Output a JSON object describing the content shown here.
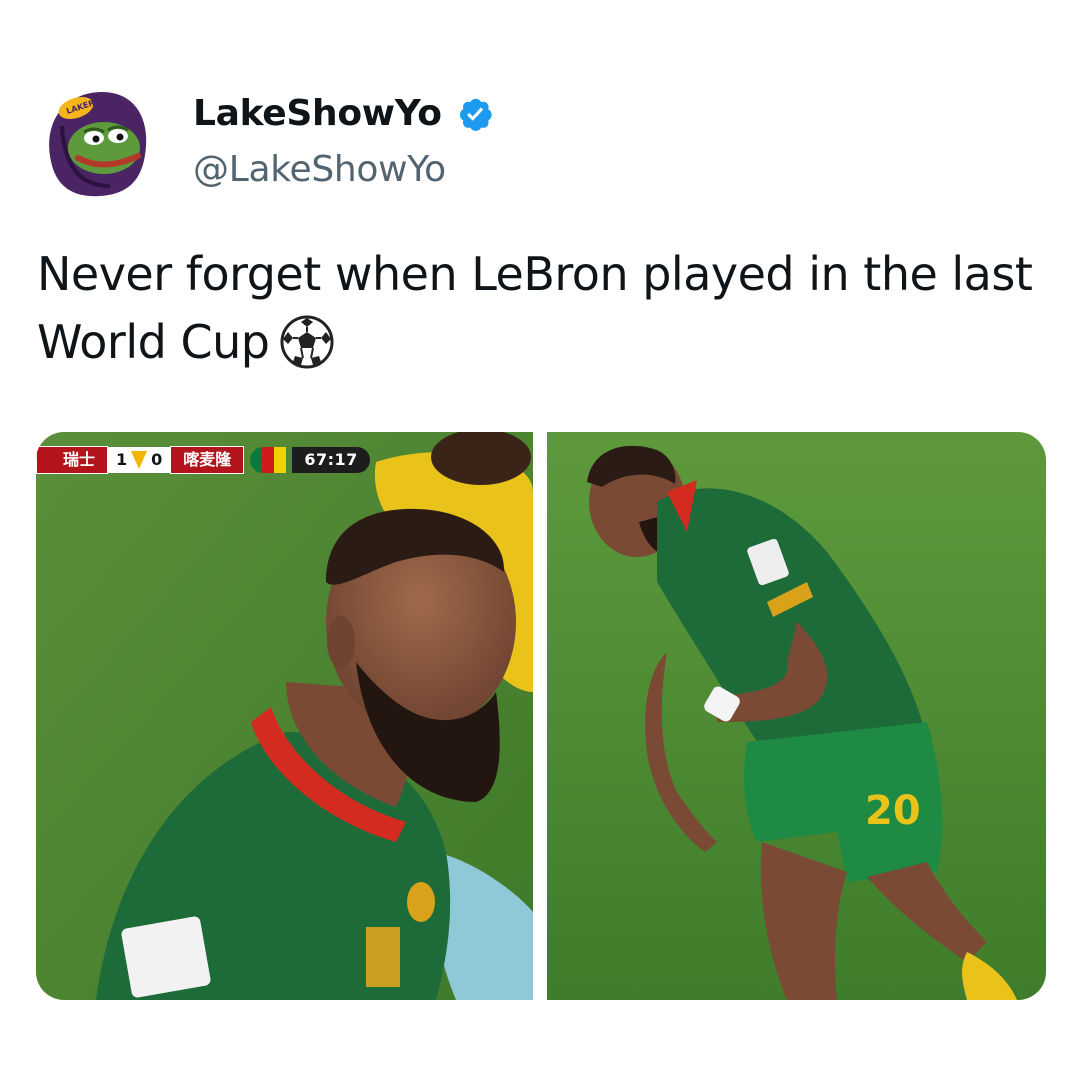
{
  "tweet": {
    "display_name": "LakeShowYo",
    "handle": "@LakeShowYo",
    "verified": true,
    "avatar_icon": "pepe-lakers-hood-avatar",
    "text": "Never forget when LeBron played in the last World Cup",
    "emoji_icon": "soccer-ball-icon"
  },
  "media": {
    "left_photo": {
      "scorebug": {
        "home_team": "瑞士",
        "home_score": "1",
        "away_score": "0",
        "away_team": "喀麦隆",
        "clock": "67:17"
      }
    },
    "right_photo": {
      "jersey_number": "20"
    }
  },
  "colors": {
    "verified_badge": "#1d9bf0",
    "handle": "#536471",
    "text": "#0f1419",
    "pitch": "#4f8a2e",
    "jersey_green": "#1e6b3a",
    "collar_red": "#d32b1f"
  }
}
